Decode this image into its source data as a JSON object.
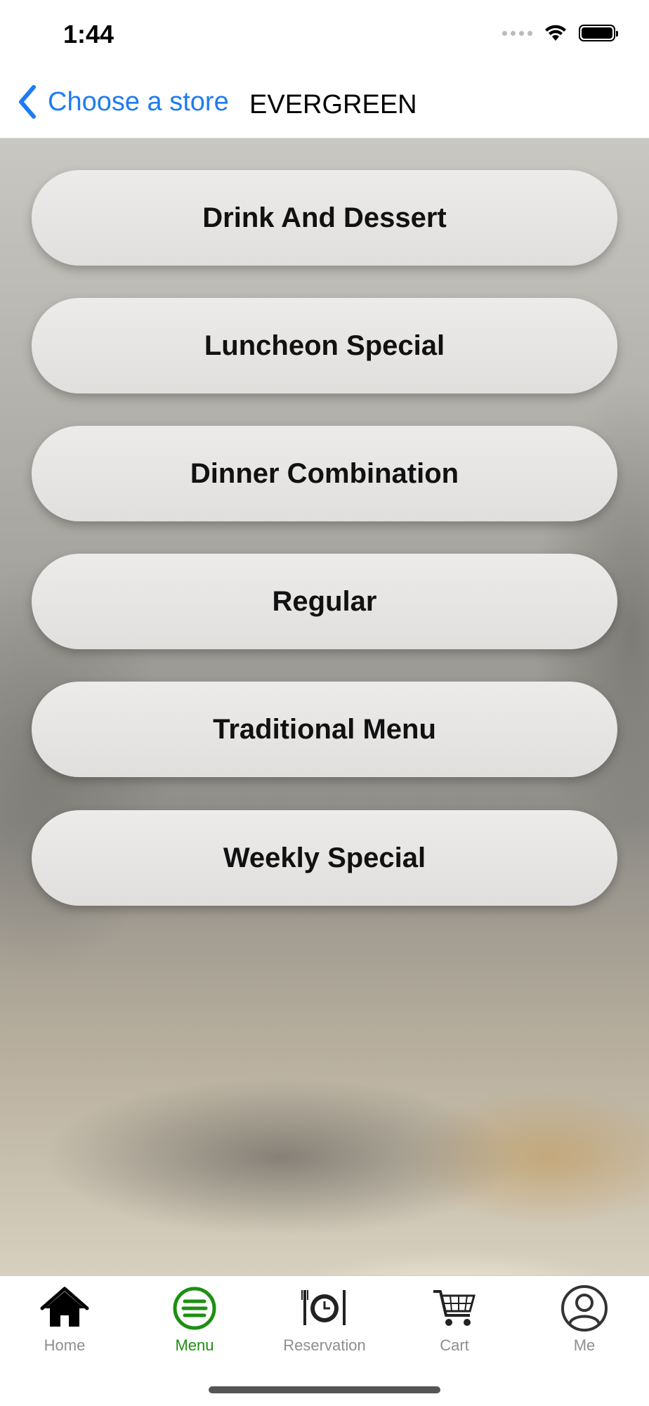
{
  "status": {
    "time": "1:44"
  },
  "nav": {
    "back_label": "Choose a store",
    "title": "EVERGREEN"
  },
  "menu": {
    "items": [
      {
        "label": "Drink And Dessert"
      },
      {
        "label": "Luncheon Special"
      },
      {
        "label": "Dinner Combination"
      },
      {
        "label": "Regular"
      },
      {
        "label": "Traditional Menu"
      },
      {
        "label": "Weekly Special"
      }
    ]
  },
  "tabs": [
    {
      "label": "Home",
      "icon": "home-icon",
      "active": false
    },
    {
      "label": "Menu",
      "icon": "menu-icon",
      "active": true
    },
    {
      "label": "Reservation",
      "icon": "reservation-icon",
      "active": false
    },
    {
      "label": "Cart",
      "icon": "cart-icon",
      "active": false
    },
    {
      "label": "Me",
      "icon": "profile-icon",
      "active": false
    }
  ],
  "colors": {
    "accent_blue": "#1e7cf2",
    "active_green": "#1d8f12",
    "inactive_gray": "#8e8e8e"
  }
}
